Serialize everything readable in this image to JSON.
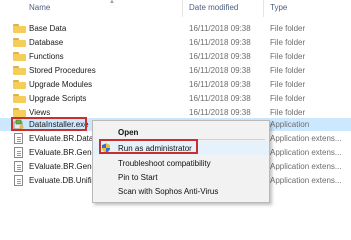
{
  "header": {
    "name": "Name",
    "date_modified": "Date modified",
    "type": "Type"
  },
  "files": [
    {
      "name": "Base Data",
      "date": "16/11/2018 09:38",
      "type": "File folder",
      "kind": "folder"
    },
    {
      "name": "Database",
      "date": "16/11/2018 09:38",
      "type": "File folder",
      "kind": "folder"
    },
    {
      "name": "Functions",
      "date": "16/11/2018 09:38",
      "type": "File folder",
      "kind": "folder"
    },
    {
      "name": "Stored Procedures",
      "date": "16/11/2018 09:38",
      "type": "File folder",
      "kind": "folder"
    },
    {
      "name": "Upgrade Modules",
      "date": "16/11/2018 09:38",
      "type": "File folder",
      "kind": "folder"
    },
    {
      "name": "Upgrade Scripts",
      "date": "16/11/2018 09:38",
      "type": "File folder",
      "kind": "folder"
    },
    {
      "name": "Views",
      "date": "16/11/2018 09:38",
      "type": "File folder",
      "kind": "folder"
    },
    {
      "name": "DataInstaller.exe",
      "date": "",
      "type": "Application",
      "kind": "exe",
      "selected": true
    },
    {
      "name": "EValuate.BR.Data",
      "date": "",
      "type": "Application extens...",
      "kind": "dll"
    },
    {
      "name": "EValuate.BR.Generi",
      "date": "",
      "type": "Application extens...",
      "kind": "dll"
    },
    {
      "name": "EValuate.BR.Generi",
      "date": "",
      "type": "Application extens...",
      "kind": "dll"
    },
    {
      "name": "Evaluate.DB.Unifie",
      "date": "",
      "type": "Application extens...",
      "kind": "dll"
    }
  ],
  "context_menu": {
    "open": "Open",
    "run_as_admin": "Run as administrator",
    "troubleshoot": "Troubleshoot compatibility",
    "pin_to_start": "Pin to Start",
    "scan": "Scan with Sophos Anti-Virus"
  },
  "colors": {
    "selection": "#cce8ff",
    "highlight_border": "#c9302c",
    "folder": "#f5cd5a"
  }
}
